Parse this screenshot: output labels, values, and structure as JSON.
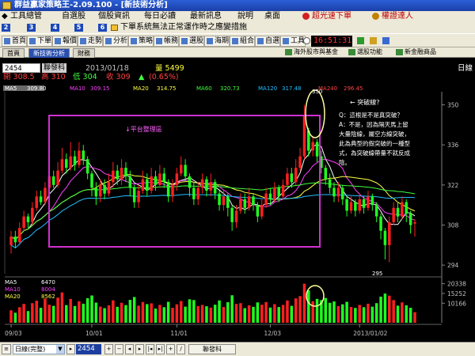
{
  "app": {
    "title": "群益贏家策略王-2.09.100 - [新技術分析]"
  },
  "menu": {
    "items": [
      "工具總管",
      "自選股",
      "個股資訊",
      "每日必讀",
      "最新訊息",
      "說明",
      "桌面",
      "超光速下單",
      "權證達人"
    ]
  },
  "quickbar": {
    "numbers": [
      "2",
      "3",
      "4",
      "5",
      "6"
    ],
    "marquee": "下單系統無法正常運作時之應變措施"
  },
  "toolbar": {
    "buttons": [
      "首頁",
      "下單",
      "報價",
      "走勢",
      "分析",
      "策略",
      "帳務",
      "選股",
      "海期",
      "組合",
      "自選",
      "工具"
    ],
    "clock": "16:51:31",
    "right_buttons": [
      "海外股市與基金",
      "選股功能",
      "新金融商品"
    ]
  },
  "tabs": {
    "items": [
      "首頁",
      "新技術分析",
      "財務"
    ]
  },
  "quote": {
    "code": "2454",
    "name": "聯發科",
    "date": "2013/01/18",
    "volume": "量 5499",
    "open": "開 308.5",
    "high": "高 310",
    "low": "低 304",
    "close": "收 309",
    "change": "(0.65%)",
    "period": "日線"
  },
  "indicators": {
    "ma5_label": "MA5",
    "ma5_value": "309.80",
    "ma10_label": "MA10",
    "ma10_value": "309.15",
    "ma20_label": "MA20",
    "ma20_value": "314.75",
    "ma60_label": "MA60",
    "ma60_value": "320.73",
    "ma120_label": "MA120",
    "ma120_value": "317.48",
    "ma240_label": "MA240",
    "ma240_value": "296.45"
  },
  "volume_legend": {
    "ma5_label": "MA5",
    "ma5_value": "6470",
    "ma10_label": "MA10",
    "ma10_value": "8004",
    "ma20_label": "MA20",
    "ma20_value": "8562"
  },
  "annotations": {
    "platform": "↓平台整理區",
    "breakout": "← 突破線?",
    "qa": [
      "Q：這根是不是真突破？",
      "A：不是，因為隔天馬上留",
      "大量陰線，屬空方線突破，",
      "此為典型的假突破的一種型",
      "式，為突破線帶量不就反成",
      "陰。"
    ]
  },
  "colors": {
    "ma5": "#ffffff",
    "ma10": "#ff40ff",
    "ma20": "#ffff40",
    "ma60": "#40ff40",
    "ma120": "#20c0ff",
    "ma240": "#ff4040",
    "up": "#ff2020",
    "down": "#20ff20",
    "frame": "#d030d0",
    "circle": "#ffffa0"
  },
  "bottom": {
    "period_select": "日線(完整)",
    "code": "2454",
    "button": "聯發科"
  },
  "chart_data": {
    "type": "candlestick",
    "price_axis": {
      "ticks": [
        350,
        336,
        322,
        308,
        294
      ],
      "ylim": [
        291,
        354
      ]
    },
    "volume_axis": {
      "ticks": [
        20338,
        15252,
        10166
      ]
    },
    "date_labels": [
      "09/03",
      "10/01",
      "11/01",
      "12/03",
      "2013/01/02"
    ],
    "markers": {
      "high": "350",
      "low": "295"
    },
    "candles": [
      {
        "o": 301,
        "c": 304,
        "h": 306,
        "l": 298,
        "v": 6500
      },
      {
        "o": 304,
        "c": 302,
        "h": 306,
        "l": 300,
        "v": 5200
      },
      {
        "o": 302,
        "c": 307,
        "h": 309,
        "l": 301,
        "v": 8100
      },
      {
        "o": 307,
        "c": 311,
        "h": 313,
        "l": 306,
        "v": 9800
      },
      {
        "o": 311,
        "c": 309,
        "h": 312,
        "l": 307,
        "v": 6100
      },
      {
        "o": 309,
        "c": 314,
        "h": 316,
        "l": 308,
        "v": 10200
      },
      {
        "o": 314,
        "c": 318,
        "h": 320,
        "l": 313,
        "v": 11500
      },
      {
        "o": 318,
        "c": 316,
        "h": 320,
        "l": 315,
        "v": 7800
      },
      {
        "o": 316,
        "c": 321,
        "h": 323,
        "l": 315,
        "v": 12600
      },
      {
        "o": 321,
        "c": 325,
        "h": 327,
        "l": 319,
        "v": 9400
      },
      {
        "o": 325,
        "c": 322,
        "h": 327,
        "l": 321,
        "v": 8800
      },
      {
        "o": 322,
        "c": 327,
        "h": 330,
        "l": 321,
        "v": 13100
      },
      {
        "o": 327,
        "c": 331,
        "h": 335,
        "l": 326,
        "v": 15800
      },
      {
        "o": 331,
        "c": 328,
        "h": 333,
        "l": 326,
        "v": 9200
      },
      {
        "o": 328,
        "c": 332,
        "h": 337,
        "l": 327,
        "v": 12400
      },
      {
        "o": 332,
        "c": 329,
        "h": 334,
        "l": 327,
        "v": 8700
      },
      {
        "o": 329,
        "c": 334,
        "h": 337,
        "l": 328,
        "v": 11200
      },
      {
        "o": 334,
        "c": 331,
        "h": 336,
        "l": 329,
        "v": 9900
      },
      {
        "o": 331,
        "c": 326,
        "h": 332,
        "l": 324,
        "v": 12800
      },
      {
        "o": 326,
        "c": 321,
        "h": 327,
        "l": 318,
        "v": 14200
      },
      {
        "o": 321,
        "c": 318,
        "h": 323,
        "l": 315,
        "v": 10500
      },
      {
        "o": 318,
        "c": 322,
        "h": 324,
        "l": 316,
        "v": 8400
      },
      {
        "o": 322,
        "c": 319,
        "h": 324,
        "l": 317,
        "v": 7600
      },
      {
        "o": 319,
        "c": 323,
        "h": 326,
        "l": 318,
        "v": 9100
      },
      {
        "o": 323,
        "c": 327,
        "h": 330,
        "l": 321,
        "v": 11700
      },
      {
        "o": 327,
        "c": 324,
        "h": 329,
        "l": 322,
        "v": 8300
      },
      {
        "o": 324,
        "c": 328,
        "h": 331,
        "l": 322,
        "v": 10400
      },
      {
        "o": 328,
        "c": 325,
        "h": 330,
        "l": 323,
        "v": 9200
      },
      {
        "o": 325,
        "c": 321,
        "h": 327,
        "l": 318,
        "v": 11900
      },
      {
        "o": 321,
        "c": 316,
        "h": 322,
        "l": 314,
        "v": 13400
      },
      {
        "o": 316,
        "c": 320,
        "h": 322,
        "l": 314,
        "v": 8900
      },
      {
        "o": 320,
        "c": 324,
        "h": 327,
        "l": 319,
        "v": 10800
      },
      {
        "o": 324,
        "c": 320,
        "h": 326,
        "l": 318,
        "v": 9700
      },
      {
        "o": 320,
        "c": 325,
        "h": 328,
        "l": 319,
        "v": 10100
      },
      {
        "o": 325,
        "c": 322,
        "h": 327,
        "l": 320,
        "v": 7400
      },
      {
        "o": 322,
        "c": 326,
        "h": 329,
        "l": 321,
        "v": 9300
      },
      {
        "o": 326,
        "c": 323,
        "h": 328,
        "l": 321,
        "v": 8100
      },
      {
        "o": 323,
        "c": 318,
        "h": 324,
        "l": 316,
        "v": 10900
      },
      {
        "o": 318,
        "c": 322,
        "h": 324,
        "l": 316,
        "v": 7800
      },
      {
        "o": 322,
        "c": 326,
        "h": 328,
        "l": 320,
        "v": 9600
      },
      {
        "o": 326,
        "c": 329,
        "h": 332,
        "l": 325,
        "v": 11300
      },
      {
        "o": 329,
        "c": 325,
        "h": 331,
        "l": 323,
        "v": 8400
      },
      {
        "o": 325,
        "c": 321,
        "h": 326,
        "l": 318,
        "v": 12200
      },
      {
        "o": 321,
        "c": 317,
        "h": 323,
        "l": 315,
        "v": 11800
      },
      {
        "o": 317,
        "c": 321,
        "h": 323,
        "l": 315,
        "v": 8700
      },
      {
        "o": 321,
        "c": 324,
        "h": 326,
        "l": 319,
        "v": 9300
      },
      {
        "o": 324,
        "c": 320,
        "h": 325,
        "l": 318,
        "v": 8600
      },
      {
        "o": 320,
        "c": 323,
        "h": 326,
        "l": 318,
        "v": 7900
      },
      {
        "o": 323,
        "c": 319,
        "h": 324,
        "l": 317,
        "v": 9400
      },
      {
        "o": 319,
        "c": 315,
        "h": 320,
        "l": 313,
        "v": 11600
      },
      {
        "o": 315,
        "c": 318,
        "h": 320,
        "l": 313,
        "v": 8200
      },
      {
        "o": 318,
        "c": 314,
        "h": 319,
        "l": 311,
        "v": 10700
      },
      {
        "o": 314,
        "c": 309,
        "h": 315,
        "l": 306,
        "v": 14300
      },
      {
        "o": 309,
        "c": 313,
        "h": 315,
        "l": 307,
        "v": 9800
      },
      {
        "o": 313,
        "c": 317,
        "h": 319,
        "l": 312,
        "v": 10200
      },
      {
        "o": 317,
        "c": 314,
        "h": 319,
        "l": 312,
        "v": 7600
      },
      {
        "o": 314,
        "c": 318,
        "h": 321,
        "l": 313,
        "v": 9100
      },
      {
        "o": 318,
        "c": 315,
        "h": 319,
        "l": 313,
        "v": 8300
      },
      {
        "o": 315,
        "c": 311,
        "h": 316,
        "l": 309,
        "v": 10600
      },
      {
        "o": 311,
        "c": 315,
        "h": 317,
        "l": 310,
        "v": 9400
      },
      {
        "o": 315,
        "c": 319,
        "h": 321,
        "l": 314,
        "v": 10800
      },
      {
        "o": 319,
        "c": 317,
        "h": 321,
        "l": 315,
        "v": 7900
      },
      {
        "o": 317,
        "c": 321,
        "h": 323,
        "l": 316,
        "v": 9700
      },
      {
        "o": 321,
        "c": 318,
        "h": 322,
        "l": 316,
        "v": 8200
      },
      {
        "o": 318,
        "c": 322,
        "h": 324,
        "l": 317,
        "v": 9300
      },
      {
        "o": 322,
        "c": 326,
        "h": 328,
        "l": 321,
        "v": 11600
      },
      {
        "o": 326,
        "c": 323,
        "h": 328,
        "l": 321,
        "v": 8800
      },
      {
        "o": 323,
        "c": 328,
        "h": 331,
        "l": 322,
        "v": 12700
      },
      {
        "o": 328,
        "c": 332,
        "h": 335,
        "l": 327,
        "v": 13900
      },
      {
        "o": 332,
        "c": 346,
        "h": 350,
        "l": 331,
        "v": 20338
      },
      {
        "o": 341,
        "c": 334,
        "h": 342,
        "l": 332,
        "v": 16900
      },
      {
        "o": 334,
        "c": 337,
        "h": 339,
        "l": 332,
        "v": 11200
      },
      {
        "o": 337,
        "c": 332,
        "h": 338,
        "l": 330,
        "v": 12400
      },
      {
        "o": 332,
        "c": 328,
        "h": 334,
        "l": 326,
        "v": 11800
      },
      {
        "o": 328,
        "c": 324,
        "h": 329,
        "l": 322,
        "v": 12900
      },
      {
        "o": 324,
        "c": 321,
        "h": 326,
        "l": 319,
        "v": 10400
      },
      {
        "o": 321,
        "c": 318,
        "h": 323,
        "l": 316,
        "v": 11100
      },
      {
        "o": 318,
        "c": 321,
        "h": 323,
        "l": 316,
        "v": 8700
      },
      {
        "o": 321,
        "c": 317,
        "h": 322,
        "l": 315,
        "v": 9600
      },
      {
        "o": 317,
        "c": 313,
        "h": 318,
        "l": 311,
        "v": 10900
      },
      {
        "o": 313,
        "c": 316,
        "h": 318,
        "l": 312,
        "v": 8200
      },
      {
        "o": 316,
        "c": 313,
        "h": 317,
        "l": 311,
        "v": 7700
      },
      {
        "o": 313,
        "c": 317,
        "h": 319,
        "l": 312,
        "v": 9300
      },
      {
        "o": 317,
        "c": 314,
        "h": 318,
        "l": 312,
        "v": 8100
      },
      {
        "o": 314,
        "c": 318,
        "h": 320,
        "l": 313,
        "v": 9900
      },
      {
        "o": 318,
        "c": 315,
        "h": 319,
        "l": 313,
        "v": 8400
      },
      {
        "o": 315,
        "c": 311,
        "h": 316,
        "l": 309,
        "v": 10200
      },
      {
        "o": 311,
        "c": 306,
        "h": 312,
        "l": 303,
        "v": 13600
      },
      {
        "o": 306,
        "c": 301,
        "h": 307,
        "l": 296,
        "v": 15200
      },
      {
        "o": 301,
        "c": 309,
        "h": 311,
        "l": 295,
        "v": 14100
      },
      {
        "o": 309,
        "c": 314,
        "h": 316,
        "l": 308,
        "v": 11800
      },
      {
        "o": 314,
        "c": 311,
        "h": 316,
        "l": 309,
        "v": 8900
      },
      {
        "o": 311,
        "c": 316,
        "h": 318,
        "l": 310,
        "v": 10600
      },
      {
        "o": 316,
        "c": 312,
        "h": 317,
        "l": 309,
        "v": 9100
      },
      {
        "o": 312,
        "c": 308,
        "h": 313,
        "l": 305,
        "v": 7800
      },
      {
        "o": 308.5,
        "c": 309,
        "h": 310,
        "l": 304,
        "v": 5499
      }
    ]
  }
}
